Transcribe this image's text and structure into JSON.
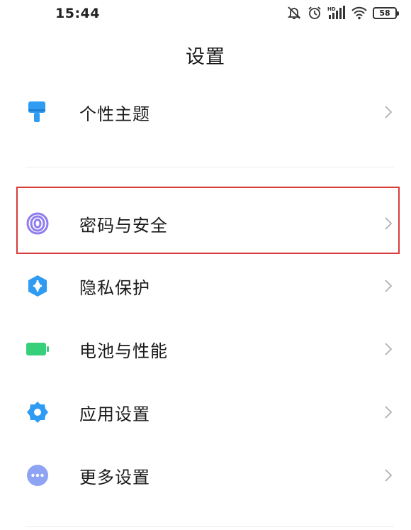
{
  "status_bar": {
    "time": "15:44",
    "battery_level": "58",
    "icons": [
      "mute-bell-icon",
      "alarm-icon",
      "hd-signal-icon",
      "wifi-icon",
      "battery-icon"
    ]
  },
  "header": {
    "title": "设置"
  },
  "settings": {
    "items": [
      {
        "label": "个性主题",
        "icon": "theme-brush-icon",
        "icon_color": "#2f9bf2"
      },
      {
        "label": "密码与安全",
        "icon": "fingerprint-icon",
        "icon_color": "#8e7cf0"
      },
      {
        "label": "隐私保护",
        "icon": "privacy-shield-icon",
        "icon_color": "#2f9bf2"
      },
      {
        "label": "电池与性能",
        "icon": "battery-performance-icon",
        "icon_color": "#36d07a"
      },
      {
        "label": "应用设置",
        "icon": "app-settings-gear-icon",
        "icon_color": "#2f9bf2"
      },
      {
        "label": "更多设置",
        "icon": "more-settings-icon",
        "icon_color": "#8ea3f3"
      }
    ]
  },
  "colors": {
    "highlight_border": "#d93a3a",
    "chevron": "#b0b0b0",
    "divider": "#ececec"
  }
}
